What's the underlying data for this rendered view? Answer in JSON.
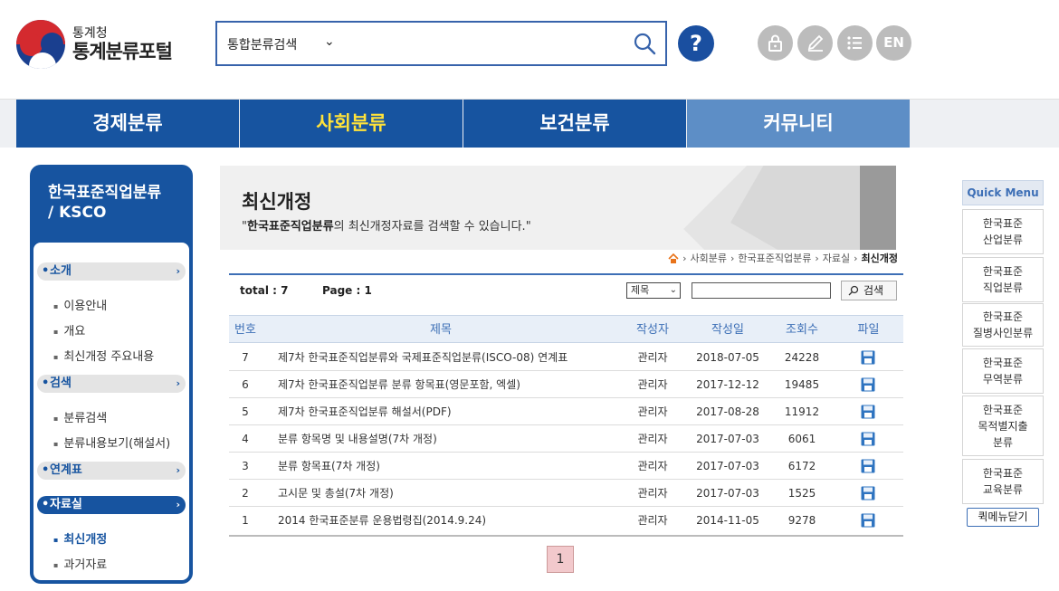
{
  "logo": {
    "small": "통계청",
    "big": "통계분류포털"
  },
  "search": {
    "category": "통합분류검색",
    "placeholder": ""
  },
  "util": {
    "en_label": "EN",
    "help_label": "?"
  },
  "nav": [
    "경제분류",
    "사회분류",
    "보건분류",
    "커뮤니티"
  ],
  "left_menu": {
    "title_line1": "한국표준직업분류",
    "title_line2": "/ KSCO",
    "groups": [
      {
        "label": "소개",
        "items": [
          "이용안내",
          "개요",
          "최신개정 주요내용"
        ]
      },
      {
        "label": "검색",
        "items": [
          "분류검색",
          "분류내용보기(해설서)"
        ]
      },
      {
        "label": "연계표",
        "items": []
      },
      {
        "label": "자료실",
        "items": [
          "최신개정",
          "과거자료"
        ]
      }
    ]
  },
  "banner": {
    "title": "최신개정",
    "desc_quote_open": "\"",
    "desc_bold": "한국표준직업분류",
    "desc_rest": "의 최신개정자료를 검색할 수 있습니다.\""
  },
  "breadcrumb": [
    "사회분류",
    "한국표준직업분류",
    "자료실",
    "최신개정"
  ],
  "list": {
    "total_label": "total : 7",
    "page_label": "Page : 1",
    "search_field": "제목",
    "search_button": "검색",
    "columns": [
      "번호",
      "제목",
      "작성자",
      "작성일",
      "조회수",
      "파일"
    ],
    "rows": [
      {
        "no": "7",
        "title": "제7차 한국표준직업분류와 국제표준직업분류(ISCO-08) 연계표",
        "author": "관리자",
        "date": "2018-07-05",
        "views": "24228"
      },
      {
        "no": "6",
        "title": "제7차 한국표준직업분류 분류 항목표(영문포함, 엑셀)",
        "author": "관리자",
        "date": "2017-12-12",
        "views": "19485"
      },
      {
        "no": "5",
        "title": "제7차 한국표준직업분류 해설서(PDF)",
        "author": "관리자",
        "date": "2017-08-28",
        "views": "11912"
      },
      {
        "no": "4",
        "title": "분류 항목명 및 내용설명(7차 개정)",
        "author": "관리자",
        "date": "2017-07-03",
        "views": "6061"
      },
      {
        "no": "3",
        "title": "분류 항목표(7차 개정)",
        "author": "관리자",
        "date": "2017-07-03",
        "views": "6172"
      },
      {
        "no": "2",
        "title": "고시문 및 총설(7차 개정)",
        "author": "관리자",
        "date": "2017-07-03",
        "views": "1525"
      },
      {
        "no": "1",
        "title": "2014 한국표준분류 운용법령집(2014.9.24)",
        "author": "관리자",
        "date": "2014-11-05",
        "views": "9278"
      }
    ],
    "page": "1"
  },
  "quick_menu": {
    "title": "Quick Menu",
    "items": [
      [
        "한국표준",
        "산업분류"
      ],
      [
        "한국표준",
        "직업분류"
      ],
      [
        "한국표준",
        "질병사인분류"
      ],
      [
        "한국표준",
        "무역분류"
      ],
      [
        "한국표준",
        "목적별지출",
        "분류"
      ],
      [
        "한국표준",
        "교육분류"
      ]
    ],
    "close_label": "퀵메뉴닫기"
  },
  "colors": {
    "primary": "#1754a0",
    "accent_yellow": "#ffe23a",
    "nav_light": "#5d8ec6",
    "page_active": "#f2c9cc"
  }
}
